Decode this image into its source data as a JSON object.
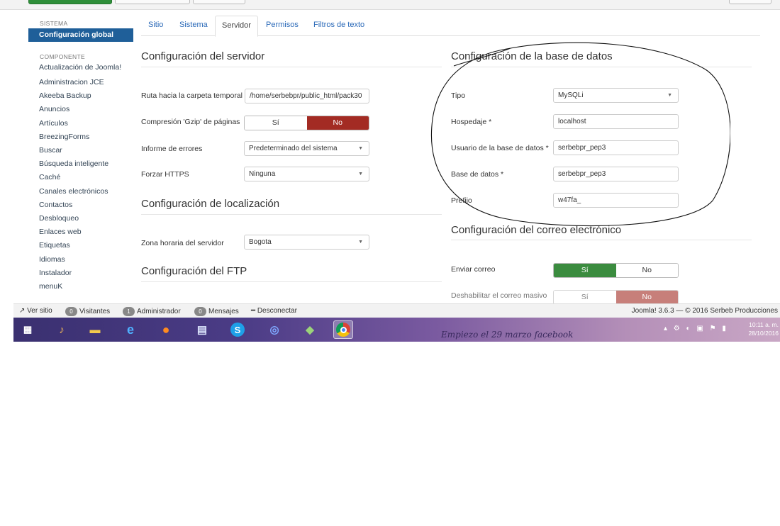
{
  "sidebar": {
    "section_system": "SISTEMA",
    "active_item": "Configuración global",
    "section_component": "COMPONENTE",
    "items": [
      "Actualización de Joomla!",
      "Administracion JCE",
      "Akeeba Backup",
      "Anuncios",
      "Artículos",
      "BreezingForms",
      "Buscar",
      "Búsqueda inteligente",
      "Caché",
      "Canales electrónicos",
      "Contactos",
      "Desbloqueo",
      "Enlaces web",
      "Etiquetas",
      "Idiomas",
      "Instalador",
      "menuK"
    ]
  },
  "tabs": [
    "Sitio",
    "Sistema",
    "Servidor",
    "Permisos",
    "Filtros de texto"
  ],
  "active_tab": "Servidor",
  "server": {
    "title": "Configuración del servidor",
    "temp_path_label": "Ruta hacia la carpeta temporal",
    "temp_path_value": "/home/serbebpr/public_html/pack30",
    "gzip_label": "Compresión 'Gzip' de páginas",
    "gzip_yes": "Sí",
    "gzip_no": "No",
    "errors_label": "Informe de errores",
    "errors_value": "Predeterminado del sistema",
    "https_label": "Forzar HTTPS",
    "https_value": "Ninguna"
  },
  "locale": {
    "title": "Configuración de localización",
    "tz_label": "Zona horaria del servidor",
    "tz_value": "Bogota"
  },
  "ftp": {
    "title": "Configuración del FTP"
  },
  "database": {
    "title": "Configuración de la base de datos",
    "type_label": "Tipo",
    "type_value": "MySQLi",
    "host_label": "Hospedaje *",
    "host_value": "localhost",
    "user_label": "Usuario de la base de datos *",
    "user_value": "serbebpr_pep3",
    "db_label": "Base de datos *",
    "db_value": "serbebpr_pep3",
    "prefix_label": "Prefijo",
    "prefix_value": "w47fa_"
  },
  "mail": {
    "title": "Configuración del correo electrónico",
    "send_label": "Enviar correo",
    "send_yes": "Sí",
    "send_no": "No",
    "mass_label": "Deshabilitar el correo masivo",
    "mass_yes": "Sí",
    "mass_no": "No"
  },
  "statusbar": {
    "view_site": "Ver sitio",
    "visitors_count": "0",
    "visitors_label": "Visitantes",
    "admin_count": "1",
    "admin_label": "Administrador",
    "messages_count": "0",
    "messages_label": "Mensajes",
    "logout": "Desconectar",
    "version": "Joomla! 3.6.3 — © 2016 Serbeb Producciones"
  },
  "taskbar": {
    "wallpaper_text": "Empiezo el 29 marzo facebook",
    "time": "10:11 a. m.",
    "date": "28/10/2016",
    "icons": [
      "start-icon",
      "winamp-icon",
      "folder-icon",
      "ie-icon",
      "firefox-icon",
      "calculator-icon",
      "skype-icon",
      "globe-icon",
      "photos-icon",
      "chrome-icon"
    ]
  },
  "colors": {
    "sidebar_active": "#1f5f99",
    "toggle_red": "#a32b23",
    "toggle_green": "#3b8c3f",
    "link_blue": "#2a69b8"
  }
}
